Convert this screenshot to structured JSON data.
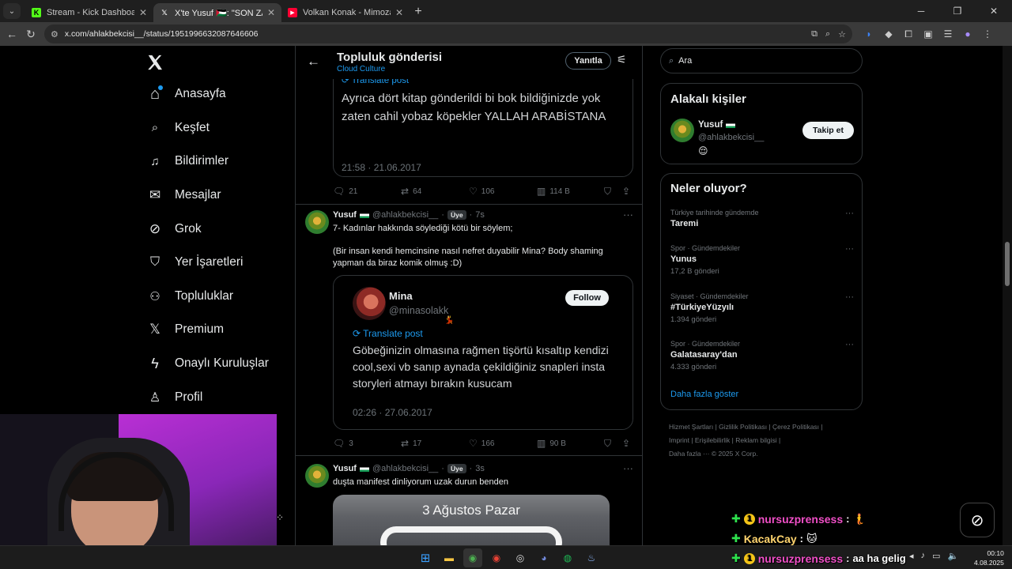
{
  "browser": {
    "tabs": [
      {
        "title": "Stream - Kick Dashboard",
        "fav": "K",
        "fav_color": "#53fc18"
      },
      {
        "title": "X'te Yusuf 🇵🇸: \"SON ZAMANLAR",
        "fav": "X",
        "fav_color": "#ffffff"
      },
      {
        "title": "Volkan Konak - Mimoza Çiçeği",
        "fav": "▶",
        "fav_color": "#ff0033"
      }
    ],
    "url": "x.com/ahlakbekcisi__/status/1951996632087646606"
  },
  "x": {
    "nav": [
      {
        "label": "Anasayfa",
        "icon": "home-icon",
        "glyph": "⌂"
      },
      {
        "label": "Keşfet",
        "icon": "search-icon",
        "glyph": "🔍"
      },
      {
        "label": "Bildirimler",
        "icon": "bell-icon",
        "glyph": "🔔"
      },
      {
        "label": "Mesajlar",
        "icon": "mail-icon",
        "glyph": "✉"
      },
      {
        "label": "Grok",
        "icon": "grok-icon",
        "glyph": "⊘"
      },
      {
        "label": "Yer İşaretleri",
        "icon": "bookmark-icon",
        "glyph": "🔖"
      },
      {
        "label": "Topluluklar",
        "icon": "communities-icon",
        "glyph": "👥"
      },
      {
        "label": "Premium",
        "icon": "x-premium-icon",
        "glyph": "𝕏"
      },
      {
        "label": "Onaylı Kuruluşlar",
        "icon": "lightning-icon",
        "glyph": "ϟ"
      },
      {
        "label": "Profil",
        "icon": "person-icon",
        "glyph": "👤"
      }
    ],
    "header": {
      "title": "Topluluk gönderisi",
      "subtitle": "Cloud Culture",
      "reply_label": "Yanıtla"
    },
    "quote1": {
      "translate": "Translate post",
      "text": "Ayrıca dört kitap gönderildi bi bok bildiğinizde yok zaten cahil yobaz köpekler YALLAH ARABİSTANA",
      "time": "21:58 · 21.06.2017"
    },
    "actions1": {
      "replies": "21",
      "reposts": "64",
      "likes": "106",
      "views": "114 B"
    },
    "tweet2": {
      "name": "Yusuf",
      "handle": "@ahlakbekcisi__",
      "badge": "Üye",
      "time": "7s",
      "line1": "7- Kadınlar hakkında söylediği kötü bir söylem;",
      "line2": "(Bir insan kendi hemcinsine nasıl nefret duyabilir Mina? Body shaming yapman da biraz komik olmuş :D)",
      "quote": {
        "name": "Mina",
        "handle": "@minasolakk",
        "emoji": "💃",
        "follow": "Follow",
        "translate": "Translate post",
        "text": "Göbeğinizin olmasına rağmen tişörtü kısaltıp kendizi cool,sexi vb sanıp aynada çekildiğiniz snapleri insta storyleri atmayı bırakın kusucam",
        "time": "02:26 · 27.06.2017"
      }
    },
    "actions2": {
      "replies": "3",
      "reposts": "17",
      "likes": "166",
      "views": "90 B"
    },
    "tweet3": {
      "name": "Yusuf",
      "handle": "@ahlakbekcisi__",
      "badge": "Üye",
      "time": "3s",
      "text": "duşta manifest dinliyorum uzak durun benden",
      "media_date": "3 Ağustos Pazar"
    },
    "search_placeholder": "Ara",
    "related": {
      "title": "Alakalı kişiler",
      "name": "Yusuf",
      "handle": "@ahlakbekcisi__",
      "emoji": "😌",
      "follow": "Takip et"
    },
    "trends": {
      "title": "Neler oluyor?",
      "items": [
        {
          "category": "Türkiye tarihinde gündemde",
          "topic": "Taremi",
          "count": ""
        },
        {
          "category": "Spor · Gündemdekiler",
          "topic": "Yunus",
          "count": "17,2 B gönderi"
        },
        {
          "category": "Siyaset · Gündemdekiler",
          "topic": "#TürkiyeYüzyılı",
          "count": "1.394 gönderi"
        },
        {
          "category": "Spor · Gündemdekiler",
          "topic": "Galatasaray'dan",
          "count": "4.333 gönderi"
        }
      ],
      "show_more": "Daha fazla göster"
    },
    "footer": {
      "line1": "Hizmet Şartları  |  Gizlilik Politikası  |  Çerez Politikası  |",
      "line2": "Imprint  |  Erişilebilirlik  |  Reklam bilgisi  |",
      "line3": "Daha fazla ···  © 2025 X Corp."
    }
  },
  "chat": [
    {
      "user": "nursuzprensess",
      "msg": "",
      "emoji": "🧜"
    },
    {
      "user": "KacakCay",
      "msg": "",
      "emoji": "🐱"
    },
    {
      "user": "nursuzprensess",
      "msg": "aa ha gelig",
      "emoji": ""
    }
  ],
  "clock": {
    "time": "00:10",
    "date": "4.08.2025"
  }
}
